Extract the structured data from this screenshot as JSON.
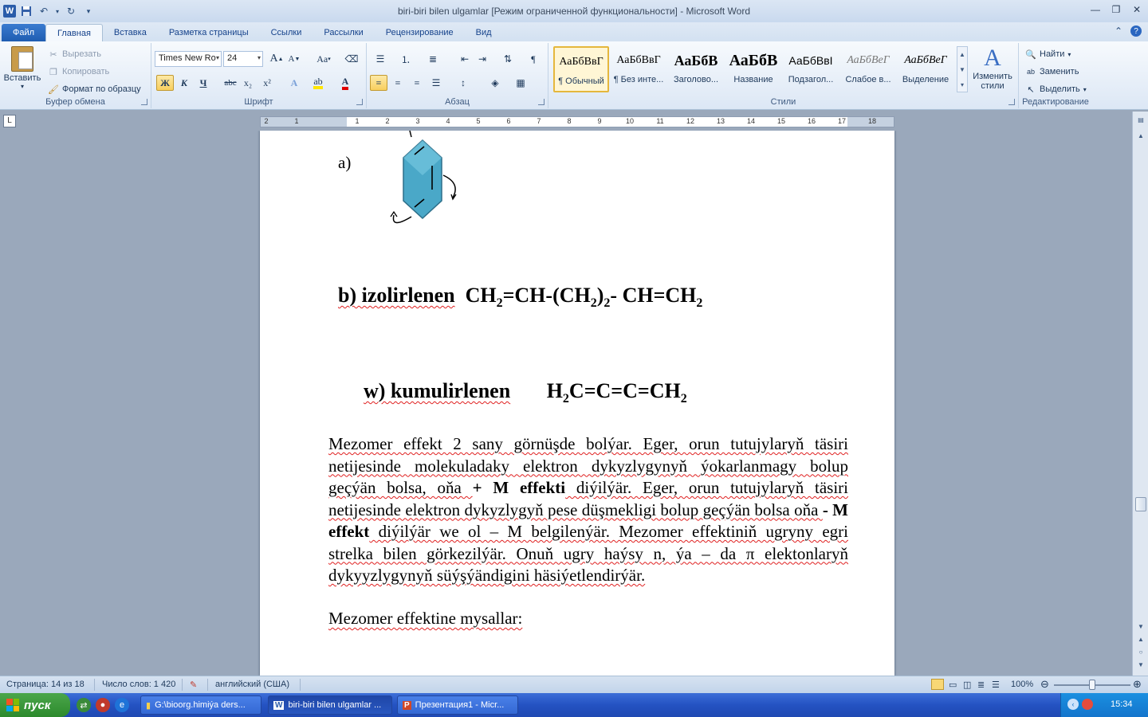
{
  "window": {
    "title": "biri-biri bilen ulgamlar [Режим ограниченной функциональности]  -  Microsoft Word",
    "app_icon": "W"
  },
  "tabs": [
    "Файл",
    "Главная",
    "Вставка",
    "Разметка страницы",
    "Ссылки",
    "Рассылки",
    "Рецензирование",
    "Вид"
  ],
  "active_tab": "Главная",
  "clipboard": {
    "paste": "Вставить",
    "cut": "Вырезать",
    "copy": "Копировать",
    "format_painter": "Формат по образцу",
    "label": "Буфер обмена"
  },
  "font_group": {
    "font_name": "Times New Ro",
    "font_size": "24",
    "bold": "Ж",
    "italic": "К",
    "underline": "Ч",
    "strike": "abc",
    "subscript": "x₂",
    "superscript": "x²",
    "grow": "A",
    "shrink": "A",
    "case": "Aa",
    "label": "Шрифт"
  },
  "paragraph_group": {
    "label": "Абзац"
  },
  "styles": {
    "label": "Стили",
    "items": [
      {
        "preview": "АаБбВвГ",
        "name": "¶ Обычный"
      },
      {
        "preview": "АаБбВвГ",
        "name": "¶ Без инте..."
      },
      {
        "preview": "АаБбВ",
        "name": "Заголово..."
      },
      {
        "preview": "АаБбВ",
        "name": "Название"
      },
      {
        "preview": "АаБбВвІ",
        "name": "Подзагол..."
      },
      {
        "preview": "АаБбВеГ",
        "name": "Слабое в..."
      },
      {
        "preview": "АаБбВеГ",
        "name": "Выделение"
      }
    ],
    "change_styles": "Изменить стили"
  },
  "editing": {
    "label": "Редактирование",
    "find": "Найти",
    "replace": "Заменить",
    "select": "Выделить"
  },
  "ruler": {
    "numbers": [
      "2",
      "1",
      "",
      "1",
      "2",
      "3",
      "4",
      "5",
      "6",
      "7",
      "8",
      "9",
      "10",
      "11",
      "12",
      "13",
      "14",
      "15",
      "16",
      "17",
      "18"
    ]
  },
  "document": {
    "label_a": "a)",
    "line_b_label": "b) izolirlenen",
    "line_b_formula_parts": [
      "CH",
      "2",
      "=CH-(CH",
      "2",
      ")",
      "2",
      "- CH=CH",
      "2"
    ],
    "line_w_label": "w) kumulirlenen",
    "line_w_formula_parts": [
      "H",
      "2",
      "C=C=C=CH",
      "2"
    ],
    "para_html_parts": {
      "p1": "Mezomer effekt 2 sany görnüşde bolýar. Eger, orun tutujylaryň täsiri netijesinde molekuladaky elektron dykyzlygynyň ýokarlanmagy bolup geçýän bolsa, oňa ",
      "p2": "+ M effekti",
      "p3": " diýilýär.  Eger, orun tutujylaryň täsiri netijesinde    elektron dykyzlygyň pese düşmekligi bolup geçýän bolsa oňa ",
      "p4": " - M  effekt",
      "p5": " diýilýär we ol – M belgilenýär. Mezomer effektiniň ugryny  egri strelka bilen görkezilýär. Onuň ugry haýsy n, ýa – da π elektonlaryň dykyyzlygynyň süýşýändigini häsiýetlendirýär."
    },
    "last_line": "Mezomer effektine mysallar:"
  },
  "status": {
    "page": "Страница: 14 из 18",
    "words": "Число слов: 1 420",
    "language": "английский (США)",
    "zoom": "100%"
  },
  "taskbar": {
    "start": "пуск",
    "items": [
      {
        "label": "G:\\bioorg.himiýa ders..."
      },
      {
        "label": "biri-biri bilen ulgamlar ..."
      },
      {
        "label": "Презентация1 - Micr..."
      }
    ],
    "lang": "EN",
    "time": "15:34"
  },
  "colors": {
    "ribbon_blue": "#15428b",
    "file_tab": "#2a66c0",
    "spell_error": "#e02020",
    "benzene_fill": "#4aa8c8"
  }
}
